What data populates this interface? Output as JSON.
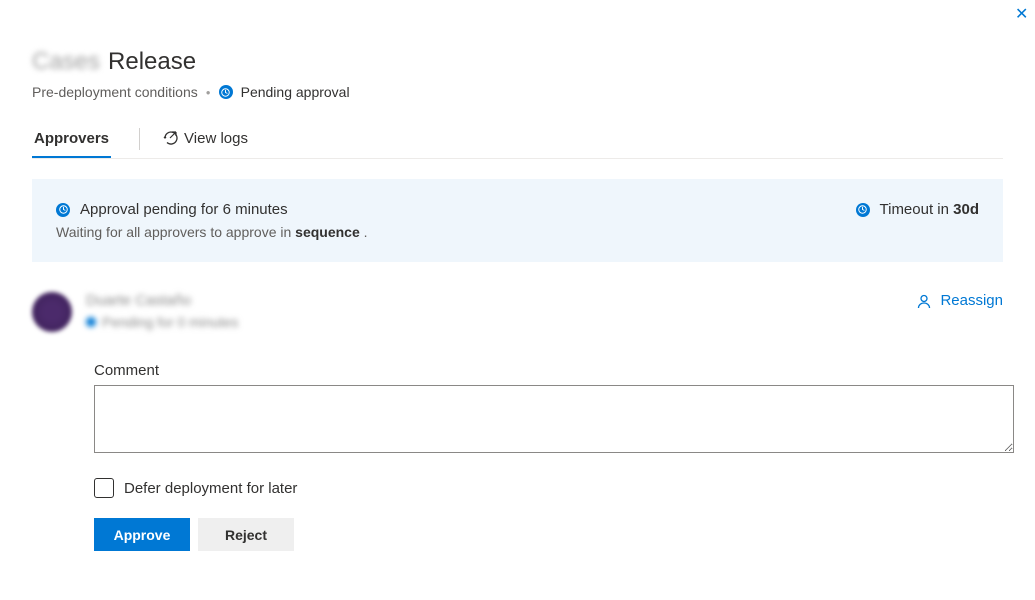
{
  "header": {
    "title_prefix_blurred": "Cases",
    "title": "Release"
  },
  "breadcrumb": {
    "item1": "Pre-deployment conditions",
    "status": "Pending approval"
  },
  "tabs": {
    "approvers": "Approvers",
    "view_logs": "View logs"
  },
  "banner": {
    "title_prefix": "Approval pending for ",
    "duration": "6 minutes",
    "subtitle_prefix": "Waiting for all approvers to approve in ",
    "subtitle_bold": "sequence",
    "subtitle_suffix": " .",
    "timeout_prefix": "Timeout in ",
    "timeout_value": "30d"
  },
  "approver": {
    "name_blurred": "Duarte Castaño",
    "status_blurred": "Pending for 0 minutes",
    "reassign": "Reassign"
  },
  "form": {
    "comment_label": "Comment",
    "comment_value": "",
    "defer_label": "Defer deployment for later",
    "approve": "Approve",
    "reject": "Reject"
  },
  "colors": {
    "accent": "#0078d4",
    "banner_bg": "#eff6fc"
  }
}
